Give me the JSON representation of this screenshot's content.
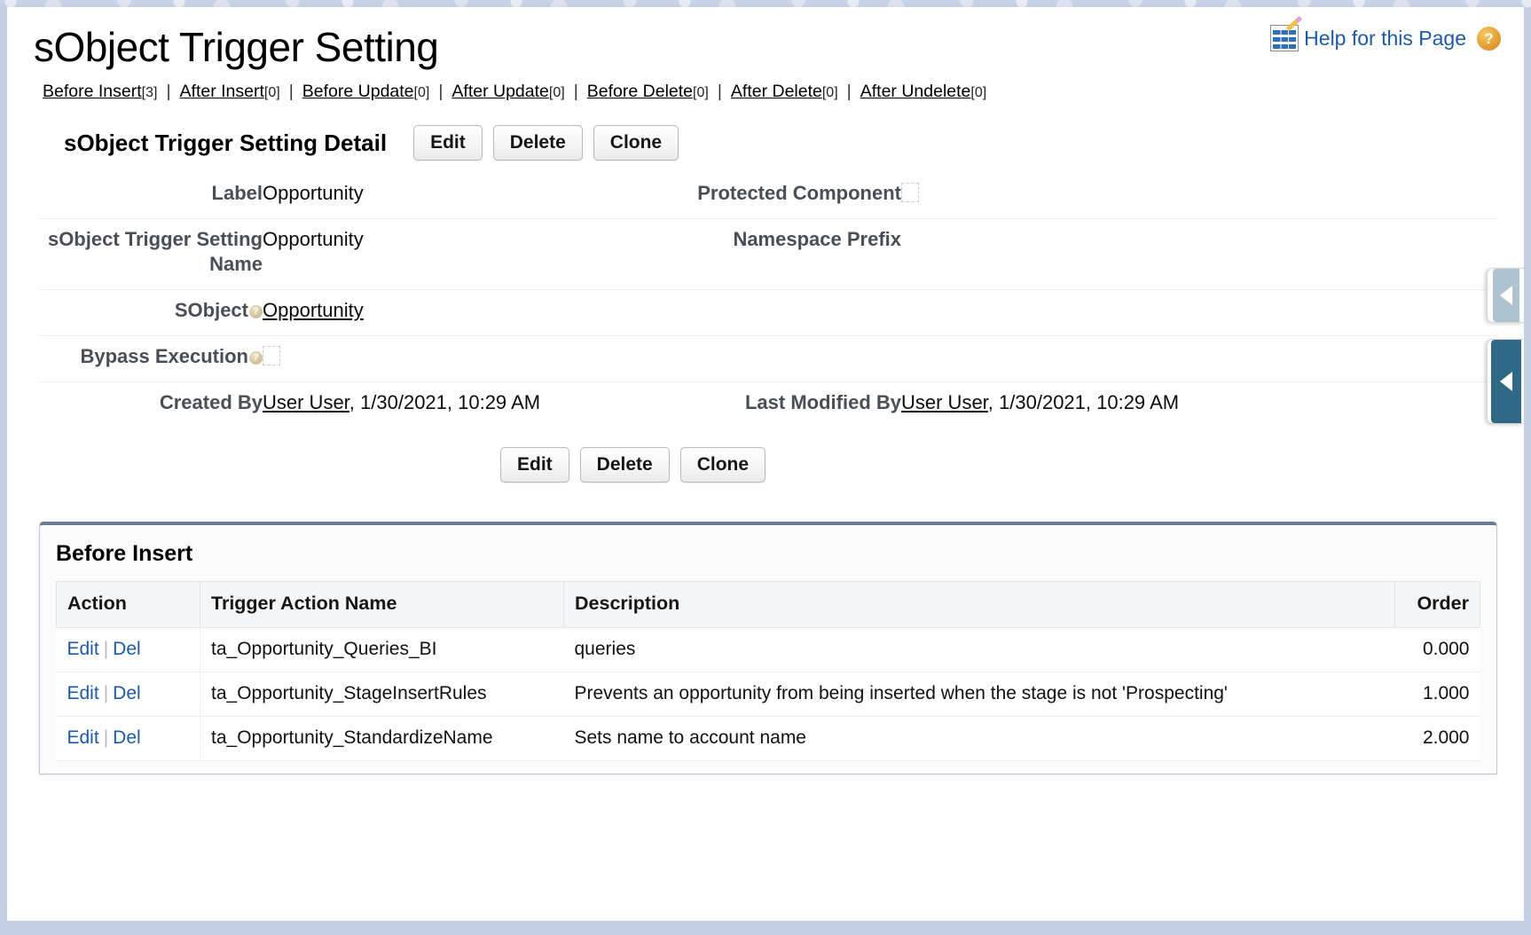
{
  "header": {
    "title": "sObject Trigger Setting",
    "help_link": "Help for this Page",
    "help_sheet_icon": "spreadsheet-edit-icon",
    "help_question_icon": "?"
  },
  "related_links": [
    {
      "label": "Before Insert",
      "count": "[3]"
    },
    {
      "label": "After Insert",
      "count": "[0]"
    },
    {
      "label": "Before Update",
      "count": "[0]"
    },
    {
      "label": "After Update",
      "count": "[0]"
    },
    {
      "label": "Before Delete",
      "count": "[0]"
    },
    {
      "label": "After Delete",
      "count": "[0]"
    },
    {
      "label": "After Undelete",
      "count": "[0]"
    }
  ],
  "separator": "|",
  "detail": {
    "title": "sObject Trigger Setting Detail",
    "buttons": {
      "edit": "Edit",
      "delete": "Delete",
      "clone": "Clone"
    },
    "fields": {
      "label_label": "Label",
      "label_value": "Opportunity",
      "protected_component_label": "Protected Component",
      "protected_component_checked": false,
      "setting_name_label": "sObject Trigger Setting Name",
      "setting_name_value": "Opportunity",
      "namespace_prefix_label": "Namespace Prefix",
      "namespace_prefix_value": "",
      "sobject_label": "SObject",
      "sobject_value": "Opportunity",
      "bypass_execution_label": "Bypass Execution",
      "bypass_execution_checked": false,
      "created_by_label": "Created By",
      "created_by_user": "User User",
      "created_by_rest": ", 1/30/2021, 10:29 AM",
      "last_modified_by_label": "Last Modified By",
      "last_modified_by_user": "User User",
      "last_modified_by_rest": ", 1/30/2021, 10:29 AM"
    }
  },
  "related_list": {
    "title": "Before Insert",
    "columns": [
      "Action",
      "Trigger Action Name",
      "Description",
      "Order"
    ],
    "action_edit": "Edit",
    "action_del": "Del",
    "action_separator": "|",
    "rows": [
      {
        "name": "ta_Opportunity_Queries_BI",
        "description": "queries",
        "order": "0.000"
      },
      {
        "name": "ta_Opportunity_StageInsertRules",
        "description": "Prevents an opportunity from being inserted when the stage is not 'Prospecting'",
        "order": "1.000"
      },
      {
        "name": "ta_Opportunity_StandardizeName",
        "description": "Sets name to account name",
        "order": "2.000"
      }
    ]
  },
  "sidebar_handles": [
    {
      "name": "collapsed-panel-handle-top",
      "icon": "chevron-left-icon"
    },
    {
      "name": "collapsed-panel-handle-bottom",
      "icon": "chevron-left-icon"
    }
  ],
  "colors": {
    "link_blue": "#1c5aa8",
    "label_gray": "#4a4f57",
    "card_border_top": "#6d7b96",
    "page_background": "#c5cfe3",
    "handle_dark": "#2e6a86",
    "handle_light": "#adc3cf"
  }
}
